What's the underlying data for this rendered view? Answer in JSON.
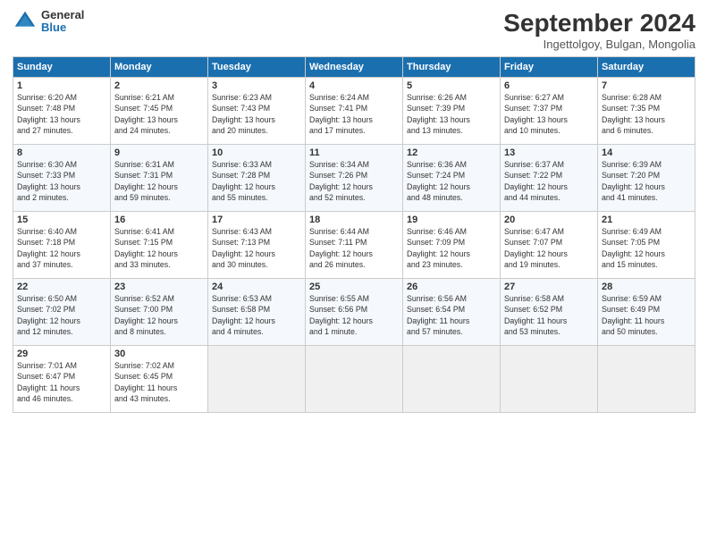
{
  "header": {
    "logo_line1": "General",
    "logo_line2": "Blue",
    "title": "September 2024",
    "location": "Ingettolgoy, Bulgan, Mongolia"
  },
  "days_of_week": [
    "Sunday",
    "Monday",
    "Tuesday",
    "Wednesday",
    "Thursday",
    "Friday",
    "Saturday"
  ],
  "weeks": [
    [
      {
        "day": "1",
        "info": "Sunrise: 6:20 AM\nSunset: 7:48 PM\nDaylight: 13 hours\nand 27 minutes."
      },
      {
        "day": "2",
        "info": "Sunrise: 6:21 AM\nSunset: 7:45 PM\nDaylight: 13 hours\nand 24 minutes."
      },
      {
        "day": "3",
        "info": "Sunrise: 6:23 AM\nSunset: 7:43 PM\nDaylight: 13 hours\nand 20 minutes."
      },
      {
        "day": "4",
        "info": "Sunrise: 6:24 AM\nSunset: 7:41 PM\nDaylight: 13 hours\nand 17 minutes."
      },
      {
        "day": "5",
        "info": "Sunrise: 6:26 AM\nSunset: 7:39 PM\nDaylight: 13 hours\nand 13 minutes."
      },
      {
        "day": "6",
        "info": "Sunrise: 6:27 AM\nSunset: 7:37 PM\nDaylight: 13 hours\nand 10 minutes."
      },
      {
        "day": "7",
        "info": "Sunrise: 6:28 AM\nSunset: 7:35 PM\nDaylight: 13 hours\nand 6 minutes."
      }
    ],
    [
      {
        "day": "8",
        "info": "Sunrise: 6:30 AM\nSunset: 7:33 PM\nDaylight: 13 hours\nand 2 minutes."
      },
      {
        "day": "9",
        "info": "Sunrise: 6:31 AM\nSunset: 7:31 PM\nDaylight: 12 hours\nand 59 minutes."
      },
      {
        "day": "10",
        "info": "Sunrise: 6:33 AM\nSunset: 7:28 PM\nDaylight: 12 hours\nand 55 minutes."
      },
      {
        "day": "11",
        "info": "Sunrise: 6:34 AM\nSunset: 7:26 PM\nDaylight: 12 hours\nand 52 minutes."
      },
      {
        "day": "12",
        "info": "Sunrise: 6:36 AM\nSunset: 7:24 PM\nDaylight: 12 hours\nand 48 minutes."
      },
      {
        "day": "13",
        "info": "Sunrise: 6:37 AM\nSunset: 7:22 PM\nDaylight: 12 hours\nand 44 minutes."
      },
      {
        "day": "14",
        "info": "Sunrise: 6:39 AM\nSunset: 7:20 PM\nDaylight: 12 hours\nand 41 minutes."
      }
    ],
    [
      {
        "day": "15",
        "info": "Sunrise: 6:40 AM\nSunset: 7:18 PM\nDaylight: 12 hours\nand 37 minutes."
      },
      {
        "day": "16",
        "info": "Sunrise: 6:41 AM\nSunset: 7:15 PM\nDaylight: 12 hours\nand 33 minutes."
      },
      {
        "day": "17",
        "info": "Sunrise: 6:43 AM\nSunset: 7:13 PM\nDaylight: 12 hours\nand 30 minutes."
      },
      {
        "day": "18",
        "info": "Sunrise: 6:44 AM\nSunset: 7:11 PM\nDaylight: 12 hours\nand 26 minutes."
      },
      {
        "day": "19",
        "info": "Sunrise: 6:46 AM\nSunset: 7:09 PM\nDaylight: 12 hours\nand 23 minutes."
      },
      {
        "day": "20",
        "info": "Sunrise: 6:47 AM\nSunset: 7:07 PM\nDaylight: 12 hours\nand 19 minutes."
      },
      {
        "day": "21",
        "info": "Sunrise: 6:49 AM\nSunset: 7:05 PM\nDaylight: 12 hours\nand 15 minutes."
      }
    ],
    [
      {
        "day": "22",
        "info": "Sunrise: 6:50 AM\nSunset: 7:02 PM\nDaylight: 12 hours\nand 12 minutes."
      },
      {
        "day": "23",
        "info": "Sunrise: 6:52 AM\nSunset: 7:00 PM\nDaylight: 12 hours\nand 8 minutes."
      },
      {
        "day": "24",
        "info": "Sunrise: 6:53 AM\nSunset: 6:58 PM\nDaylight: 12 hours\nand 4 minutes."
      },
      {
        "day": "25",
        "info": "Sunrise: 6:55 AM\nSunset: 6:56 PM\nDaylight: 12 hours\nand 1 minute."
      },
      {
        "day": "26",
        "info": "Sunrise: 6:56 AM\nSunset: 6:54 PM\nDaylight: 11 hours\nand 57 minutes."
      },
      {
        "day": "27",
        "info": "Sunrise: 6:58 AM\nSunset: 6:52 PM\nDaylight: 11 hours\nand 53 minutes."
      },
      {
        "day": "28",
        "info": "Sunrise: 6:59 AM\nSunset: 6:49 PM\nDaylight: 11 hours\nand 50 minutes."
      }
    ],
    [
      {
        "day": "29",
        "info": "Sunrise: 7:01 AM\nSunset: 6:47 PM\nDaylight: 11 hours\nand 46 minutes."
      },
      {
        "day": "30",
        "info": "Sunrise: 7:02 AM\nSunset: 6:45 PM\nDaylight: 11 hours\nand 43 minutes."
      },
      {
        "day": "",
        "info": ""
      },
      {
        "day": "",
        "info": ""
      },
      {
        "day": "",
        "info": ""
      },
      {
        "day": "",
        "info": ""
      },
      {
        "day": "",
        "info": ""
      }
    ]
  ]
}
